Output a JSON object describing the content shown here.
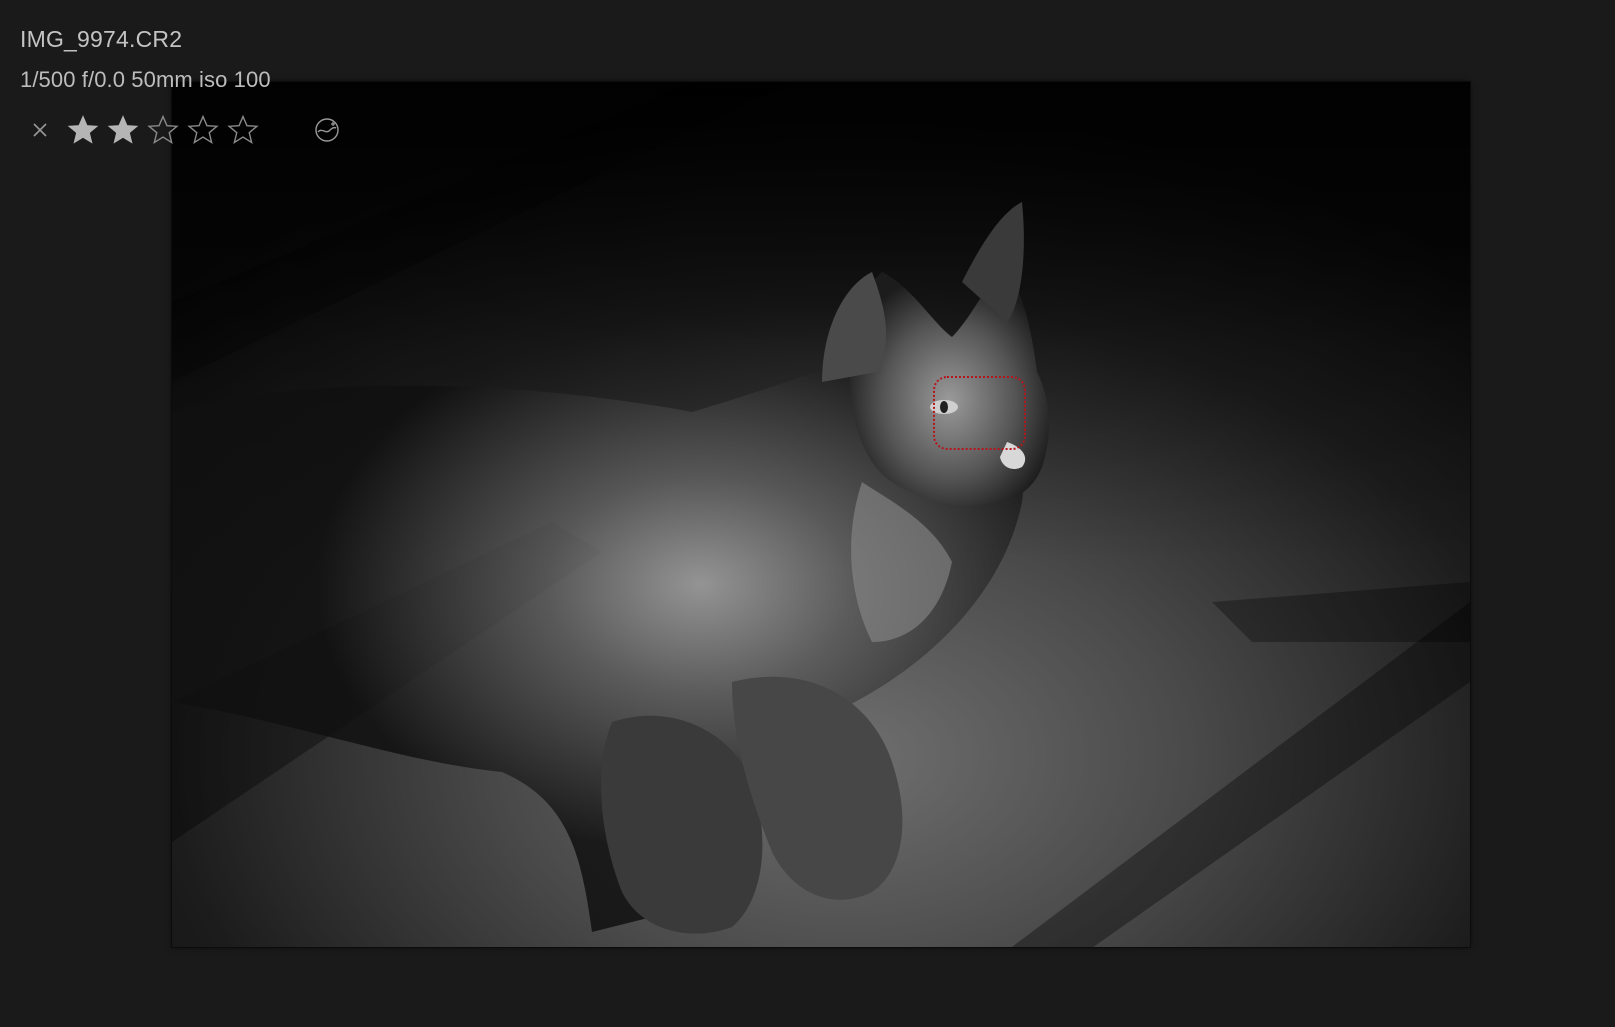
{
  "image": {
    "filename": "IMG_9974.CR2",
    "exif": "1/500 f/0.0 50mm iso 100"
  },
  "rating": {
    "stars": 2,
    "max_stars": 5
  },
  "icons": {
    "reject": "close-x-icon",
    "star_filled": "star-filled-icon",
    "star_empty": "star-outline-icon",
    "color_labels": "color-labels-icon"
  },
  "colors": {
    "background": "#1a1a1a",
    "text": "#c4c4c4",
    "focus_box": "#b8141b",
    "star_filled": "#b5b5b5",
    "star_outline": "#8a8a8a"
  }
}
